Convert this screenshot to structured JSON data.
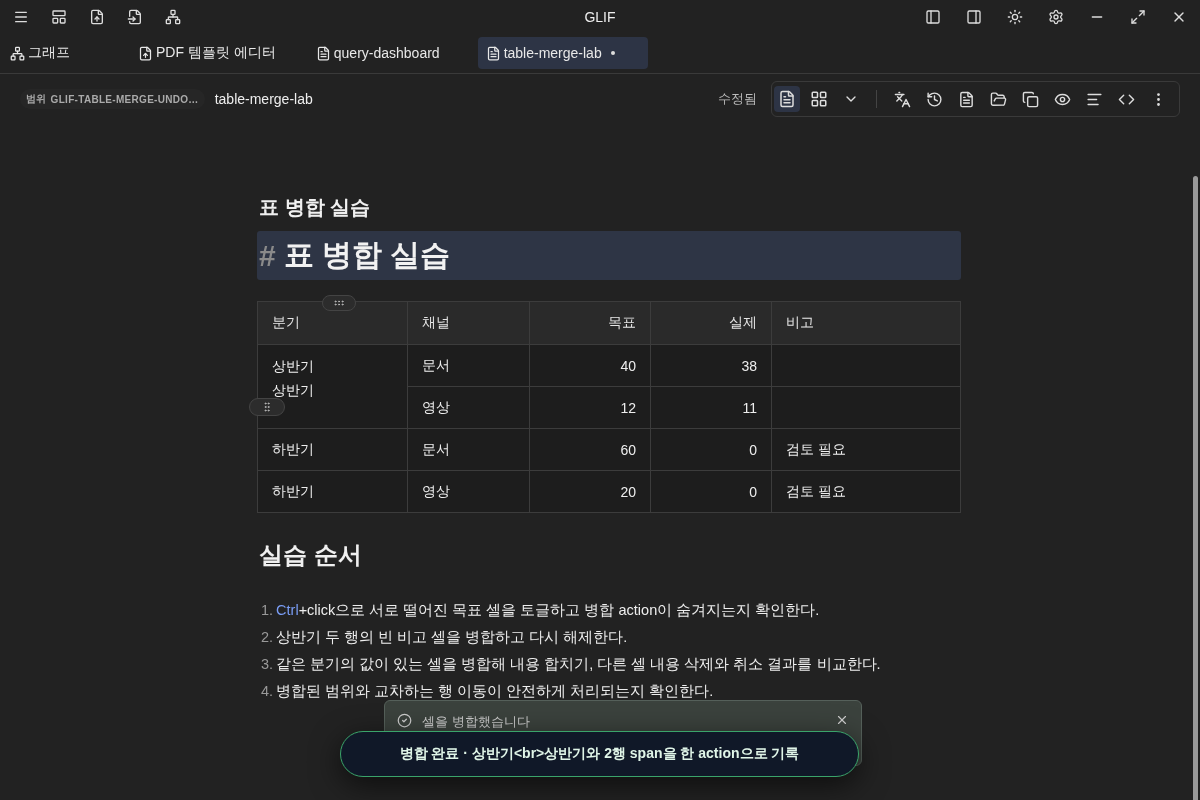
{
  "window": {
    "title": "GLIF"
  },
  "tabs": [
    {
      "label": "그래프",
      "kind": "graph",
      "selected": false,
      "modified": false
    },
    {
      "label": "PDF 템플릿 에디터",
      "kind": "pdf",
      "selected": false,
      "modified": false
    },
    {
      "label": "query-dashboard",
      "kind": "doc",
      "selected": false,
      "modified": false
    },
    {
      "label": "table-merge-lab",
      "kind": "doc",
      "selected": true,
      "modified": true
    }
  ],
  "breadcrumb": {
    "scope_label": "범위",
    "scope": "GLIF-TABLE-MERGE-UNDO…",
    "document": "table-merge-lab"
  },
  "toolbar": {
    "status": "수정됨",
    "view_modes": [
      {
        "kind": "document",
        "selected": true
      },
      {
        "kind": "grid",
        "selected": false
      }
    ]
  },
  "document": {
    "title": "표 병합 실습",
    "heading": {
      "marker": "#",
      "text": "표 병합 실습",
      "highlighted": true
    },
    "table": {
      "columns": [
        {
          "label": "분기",
          "numeric": false
        },
        {
          "label": "채널",
          "numeric": false
        },
        {
          "label": "목표",
          "numeric": true
        },
        {
          "label": "실제",
          "numeric": true
        },
        {
          "label": "비고",
          "numeric": false
        }
      ],
      "rows": [
        [
          {
            "lines": [
              "상반기",
              "상반기"
            ],
            "rowspan": 2
          },
          {
            "lines": [
              "문서"
            ]
          },
          {
            "lines": [
              "40"
            ]
          },
          {
            "lines": [
              "38"
            ]
          },
          {}
        ],
        [
          {
            "lines": [
              "영상"
            ]
          },
          {
            "lines": [
              "12"
            ]
          },
          {
            "lines": [
              "11"
            ]
          },
          {}
        ],
        [
          {
            "lines": [
              "하반기"
            ]
          },
          {
            "lines": [
              "문서"
            ]
          },
          {
            "lines": [
              "60"
            ]
          },
          {
            "lines": [
              "0"
            ]
          },
          {
            "lines": [
              "검토 필요"
            ]
          }
        ],
        [
          {
            "lines": [
              "하반기"
            ]
          },
          {
            "lines": [
              "영상"
            ]
          },
          {
            "lines": [
              "20"
            ]
          },
          {
            "lines": [
              "0"
            ]
          },
          {
            "lines": [
              "검토 필요"
            ]
          }
        ]
      ]
    },
    "section_title": "실습 순서",
    "steps": [
      {
        "number": "1.",
        "link": "Ctrl",
        "text": "+click으로 서로 떨어진 목표 셀을 토글하고 병합 action이 숨겨지는지 확인한다."
      },
      {
        "number": "2.",
        "text": "상반기 두 행의 빈 비고 셀을 병합하고 다시 해제한다."
      },
      {
        "number": "3.",
        "text": "같은 분기의 값이 있는 셀을 병합해 내용 합치기, 다른 셀 내용 삭제와 취소 결과를 비교한다."
      },
      {
        "number": "4.",
        "text": "병합된 범위와 교차하는 행 이동이 안전하게 처리되는지 확인한다."
      }
    ]
  },
  "toast": {
    "message": "셀을 병합했습니다"
  },
  "status_pill": {
    "message": "병합 완료 · 상반기<br>상반기와 2행 span을 한 action으로 기록"
  }
}
